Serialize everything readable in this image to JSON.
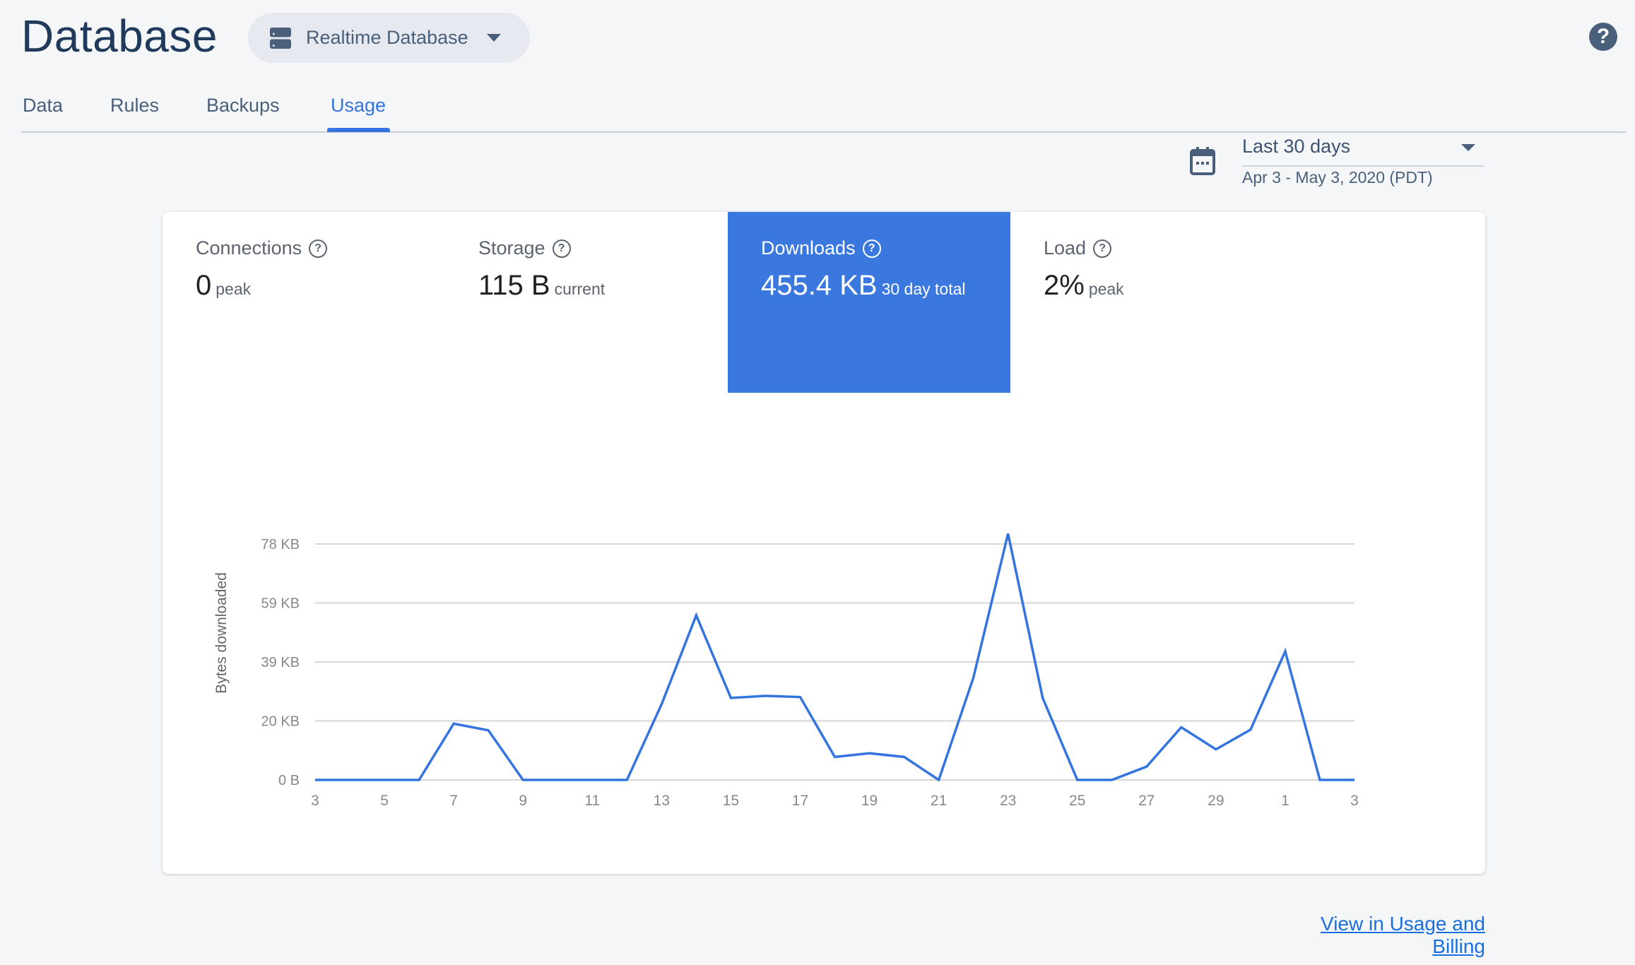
{
  "header": {
    "title": "Database",
    "db_selector": "Realtime Database",
    "help_icon": "help-circle-icon"
  },
  "tabs": [
    {
      "label": "Data"
    },
    {
      "label": "Rules"
    },
    {
      "label": "Backups"
    },
    {
      "label": "Usage",
      "active": true
    }
  ],
  "date_picker": {
    "value": "Last 30 days",
    "range": "Apr 3 - May 3, 2020 (PDT)",
    "icon": "calendar-icon"
  },
  "metrics": [
    {
      "label": "Connections",
      "value": "0",
      "sub": "peak"
    },
    {
      "label": "Storage",
      "value": "115 B",
      "sub": "current"
    },
    {
      "label": "Downloads",
      "value": "455.4 KB",
      "sub": "30 day total",
      "selected": true
    },
    {
      "label": "Load",
      "value": "2%",
      "sub": "peak"
    }
  ],
  "colors": {
    "accent": "#3474e0",
    "selected_metric": "#3a78e0",
    "line": "#3474e0"
  },
  "chart_data": {
    "type": "line",
    "ylabel": "Bytes downloaded",
    "ylim": [
      0,
      78
    ],
    "yunit": "KB",
    "yticks": [
      {
        "v": 0,
        "label": "0 B"
      },
      {
        "v": 19.5,
        "label": "20 KB"
      },
      {
        "v": 39,
        "label": "39 KB"
      },
      {
        "v": 58.5,
        "label": "59 KB"
      },
      {
        "v": 78,
        "label": "78 KB"
      }
    ],
    "xticks": [
      "3",
      "5",
      "7",
      "9",
      "11",
      "13",
      "15",
      "17",
      "19",
      "21",
      "23",
      "25",
      "27",
      "29",
      "1",
      "3"
    ],
    "x": [
      "Apr 3",
      "Apr 4",
      "Apr 5",
      "Apr 6",
      "Apr 7",
      "Apr 8",
      "Apr 9",
      "Apr 10",
      "Apr 11",
      "Apr 12",
      "Apr 13",
      "Apr 14",
      "Apr 15",
      "Apr 16",
      "Apr 17",
      "Apr 18",
      "Apr 19",
      "Apr 20",
      "Apr 21",
      "Apr 22",
      "Apr 23",
      "Apr 24",
      "Apr 25",
      "Apr 26",
      "Apr 27",
      "Apr 28",
      "Apr 29",
      "Apr 30",
      "May 1",
      "May 2",
      "May 3"
    ],
    "values": [
      0,
      0,
      0,
      0,
      18.6,
      16.4,
      0,
      0,
      0,
      0,
      25,
      54.4,
      27.1,
      27.8,
      27.4,
      7.6,
      8.8,
      7.6,
      0,
      33.8,
      81.4,
      27.1,
      0,
      0,
      4.4,
      17.4,
      10.1,
      16.6,
      42.5,
      0,
      0
    ],
    "grid": true
  },
  "footer": {
    "link": "View in Usage and Billing"
  }
}
